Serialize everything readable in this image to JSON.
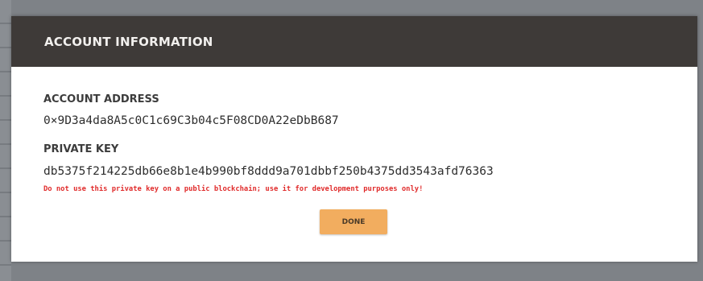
{
  "dialog": {
    "title": "ACCOUNT INFORMATION",
    "address_label": "ACCOUNT ADDRESS",
    "address_value": "0×9D3a4da8A5c0C1c69C3b04c5F08CD0A22eDbB687",
    "private_key_label": "PRIVATE KEY",
    "private_key_value": "db5375f214225db66e8b1e4b990bf8ddd9a701dbbf250b4375dd3543afd76363",
    "warning": "Do not use this private key on a public blockchain; use it for development purposes only!",
    "done_label": "DONE"
  },
  "colors": {
    "header_bg": "#3e3a38",
    "warning": "#e02b2b",
    "done_button": "#f2ad5f",
    "backdrop": "#7e8287"
  }
}
